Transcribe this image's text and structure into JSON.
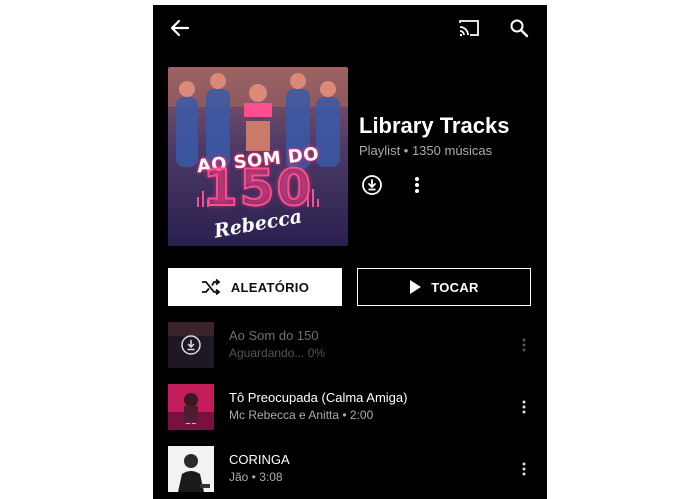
{
  "header": {
    "back_icon": "arrow-left-icon",
    "cast_icon": "cast-icon",
    "search_icon": "search-icon"
  },
  "playlist": {
    "cover": {
      "line1": "AO SOM DO",
      "line2": "150",
      "line3": "Rebecca"
    },
    "title": "Library Tracks",
    "subtitle": "Playlist • 1350 músicas",
    "download_icon": "download-icon",
    "more_icon": "more-vert-icon"
  },
  "actions": {
    "shuffle_label": "ALEATÓRIO",
    "play_label": "TOCAR"
  },
  "tracks": [
    {
      "title": "Ao Som do 150",
      "subtitle": "Aguardando... 0%",
      "state": "downloading"
    },
    {
      "title": "Tô Preocupada (Calma Amiga)",
      "subtitle": "Mc Rebecca e Anitta • 2:00",
      "state": "ready"
    },
    {
      "title": "CORINGA",
      "subtitle": "Jão • 3:08",
      "state": "ready"
    }
  ],
  "colors": {
    "background": "#000000",
    "accent_pink": "#ff4d8d",
    "primary_text": "#ffffff",
    "secondary_text": "#aaaaaa"
  }
}
